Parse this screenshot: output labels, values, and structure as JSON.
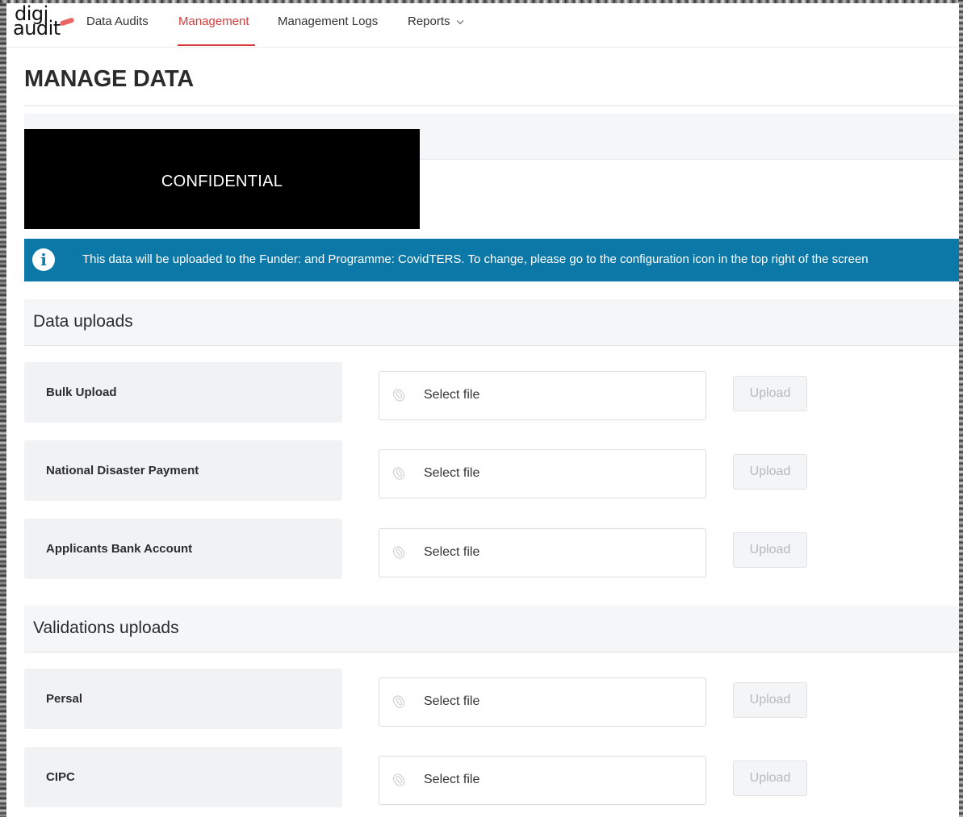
{
  "logo": {
    "line1": "digi",
    "line2": "audit"
  },
  "nav": {
    "items": [
      {
        "label": "Data Audits"
      },
      {
        "label": "Management"
      },
      {
        "label": "Management Logs"
      },
      {
        "label": "Reports"
      }
    ],
    "active": "Management"
  },
  "page": {
    "title": "MANAGE DATA"
  },
  "redaction": {
    "label": "CONFIDENTIAL"
  },
  "info_banner": {
    "icon": "info-icon",
    "text": "This data will be uploaded to the Funder:  and Programme: CovidTERS. To change, please go to the configuration icon in the top right of the screen"
  },
  "sections": [
    {
      "title": "Data uploads",
      "rows": [
        {
          "label": "Bulk Upload",
          "file_placeholder": "Select file",
          "button": "Upload"
        },
        {
          "label": "National Disaster Payment",
          "file_placeholder": "Select file",
          "button": "Upload"
        },
        {
          "label": "Applicants Bank Account",
          "file_placeholder": "Select file",
          "button": "Upload"
        }
      ]
    },
    {
      "title": "Validations uploads",
      "rows": [
        {
          "label": "Persal",
          "file_placeholder": "Select file",
          "button": "Upload"
        },
        {
          "label": "CIPC",
          "file_placeholder": "Select file",
          "button": "Upload"
        }
      ]
    }
  ],
  "colors": {
    "accent": "#d63b3b",
    "banner": "#0b78a8",
    "section_bg": "#f5f6f8",
    "disabled_text": "#b9b9b9"
  }
}
